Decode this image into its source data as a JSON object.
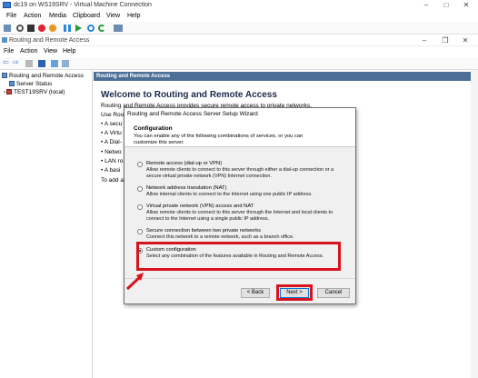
{
  "vm": {
    "title": "dc19 on WS19SRV - Virtual Machine Connection",
    "menu": [
      "File",
      "Action",
      "Media",
      "Clipboard",
      "View",
      "Help"
    ]
  },
  "mmc": {
    "title": "Routing and Remote Access",
    "menu": [
      "File",
      "Action",
      "View",
      "Help"
    ]
  },
  "tree": {
    "root": "Routing and Remote Access",
    "items": [
      "Server Status",
      "TEST19SRV (local)"
    ]
  },
  "content": {
    "header": "Routing and Remote Access",
    "welcome": "Welcome to Routing and Remote Access",
    "intro": "Routing and Remote Access provides secure remote access to private networks.",
    "use": "Use Rou",
    "bullets": [
      "• A secu",
      "• A Virtu",
      "• A Dial-",
      "• Netwo",
      "• LAN ro",
      "• A basi"
    ],
    "to_add": "To add a"
  },
  "wizard": {
    "title": "Routing and Remote Access Server Setup Wizard",
    "heading": "Configuration",
    "desc": "You can enable any of the following combinations of services, or you can customize this server.",
    "options": [
      {
        "label": "Remote access (dial-up or VPN)",
        "desc": "Allow remote clients to connect to this server through either a dial-up connection or a secure virtual private network (VPN) Internet connection."
      },
      {
        "label": "Network address translation (NAT)",
        "desc": "Allow internal clients to connect to the Internet using one public IP address."
      },
      {
        "label": "Virtual private network (VPN) access and NAT",
        "desc": "Allow remote clients to connect to this server through the Internet and local clients to connect to the Internet using a single public IP address."
      },
      {
        "label": "Secure connection between two private networks",
        "desc": "Connect this network to a remote network, such as a branch office."
      },
      {
        "label": "Custom configuration",
        "desc": "Select any combination of the features available in Routing and Remote Access."
      }
    ],
    "selected": 4,
    "back": "< Back",
    "next": "Next >",
    "cancel": "Cancel"
  },
  "colors": {
    "highlight": "#d7141e",
    "header": "#4d6f97"
  }
}
